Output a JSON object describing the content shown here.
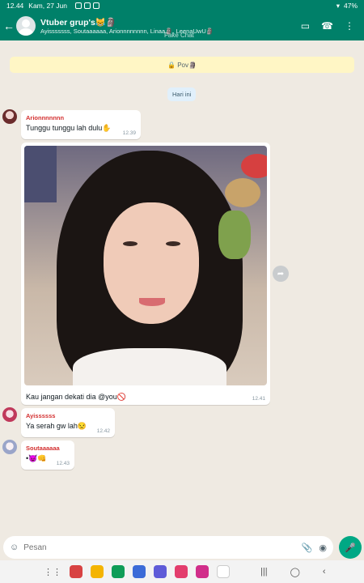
{
  "status": {
    "time": "12.44",
    "date": "Kam, 27 Jun",
    "battery": "47%"
  },
  "header": {
    "title": "Vtuber grup's😹🗿",
    "subtitle": "Ayisssssss, Soutaaaaaa, Arionnnnnnnn, Linaa🗿, LeenaUwU🗿",
    "watermark": "Fake Chat"
  },
  "chat": {
    "pinned": "🔒 Pov🗿",
    "date_chip": "Hari ini",
    "messages": [
      {
        "sender": "Arionnnnnnn",
        "text": "Tunggu tunggu lah dulu✋",
        "time": "12.39"
      },
      {
        "sender": "",
        "text": "Kau jangan dekati dia @you🚫",
        "time": "12.41"
      },
      {
        "sender": "Ayissssss",
        "text": "Ya serah gw lah😒",
        "time": "12.42"
      },
      {
        "sender": "Soutaaaaaa",
        "text": "•😈👊",
        "time": "12.43"
      }
    ]
  },
  "input": {
    "placeholder": "Pesan"
  },
  "colors": {
    "header": "#008069",
    "background": "#efeae2",
    "sender": "#d32f2f",
    "accent": "#00a884"
  },
  "icons": [
    "back-icon",
    "video-call-icon",
    "phone-icon",
    "more-icon",
    "emoji-icon",
    "attach-icon",
    "camera-icon",
    "mic-icon",
    "forward-icon"
  ]
}
